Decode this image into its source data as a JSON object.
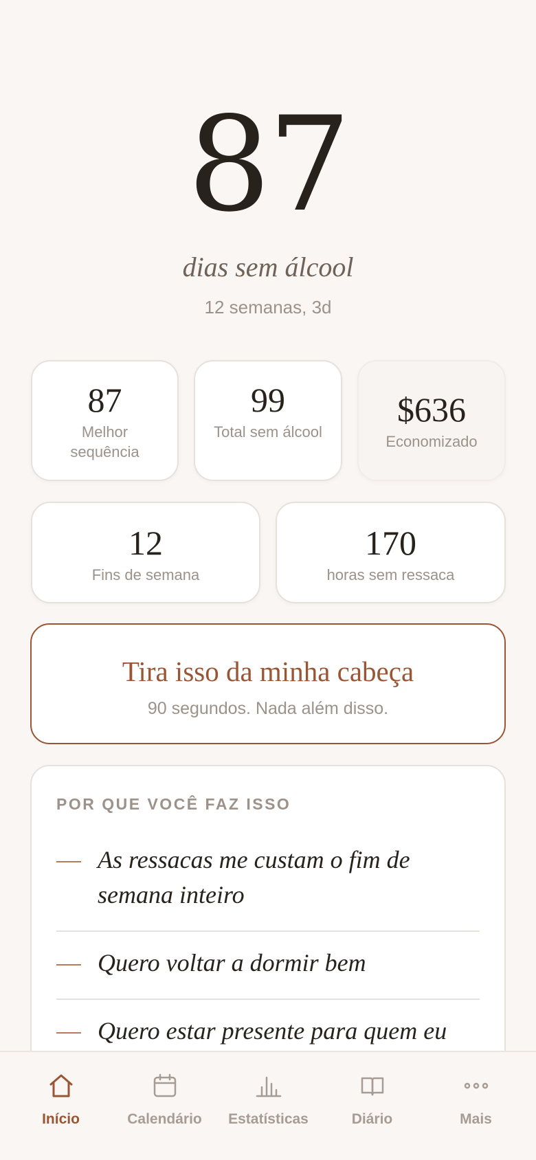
{
  "hero": {
    "days": "87",
    "caption": "dias sem álcool",
    "sub": "12 semanas, 3d"
  },
  "stats": {
    "best_streak": {
      "value": "87",
      "label": "Melhor sequência"
    },
    "total": {
      "value": "99",
      "label": "Total sem álcool"
    },
    "saved": {
      "value": "$636",
      "label": "Economizado"
    },
    "weekends": {
      "value": "12",
      "label": "Fins de semana"
    },
    "hours": {
      "value": "170",
      "label": "horas sem ressaca"
    }
  },
  "panic": {
    "title": "Tira isso da minha cabeça",
    "subtitle": "90 segundos. Nada além disso."
  },
  "why": {
    "heading": "POR QUE VOCÊ FAZ ISSO",
    "reasons": [
      "As ressacas me custam o fim de semana inteiro",
      "Quero voltar a dormir bem",
      "Quero estar presente para quem eu amo"
    ]
  },
  "tabs": [
    {
      "label": "Início",
      "icon": "home-icon",
      "active": true
    },
    {
      "label": "Calendário",
      "icon": "calendar-icon",
      "active": false
    },
    {
      "label": "Estatísticas",
      "icon": "bar-chart-icon",
      "active": false
    },
    {
      "label": "Diário",
      "icon": "book-icon",
      "active": false
    },
    {
      "label": "Mais",
      "icon": "more-dots-icon",
      "active": false
    }
  ],
  "colors": {
    "accent": "#9a5634",
    "background": "#f9f6f4",
    "muted_text": "#9c928a"
  }
}
